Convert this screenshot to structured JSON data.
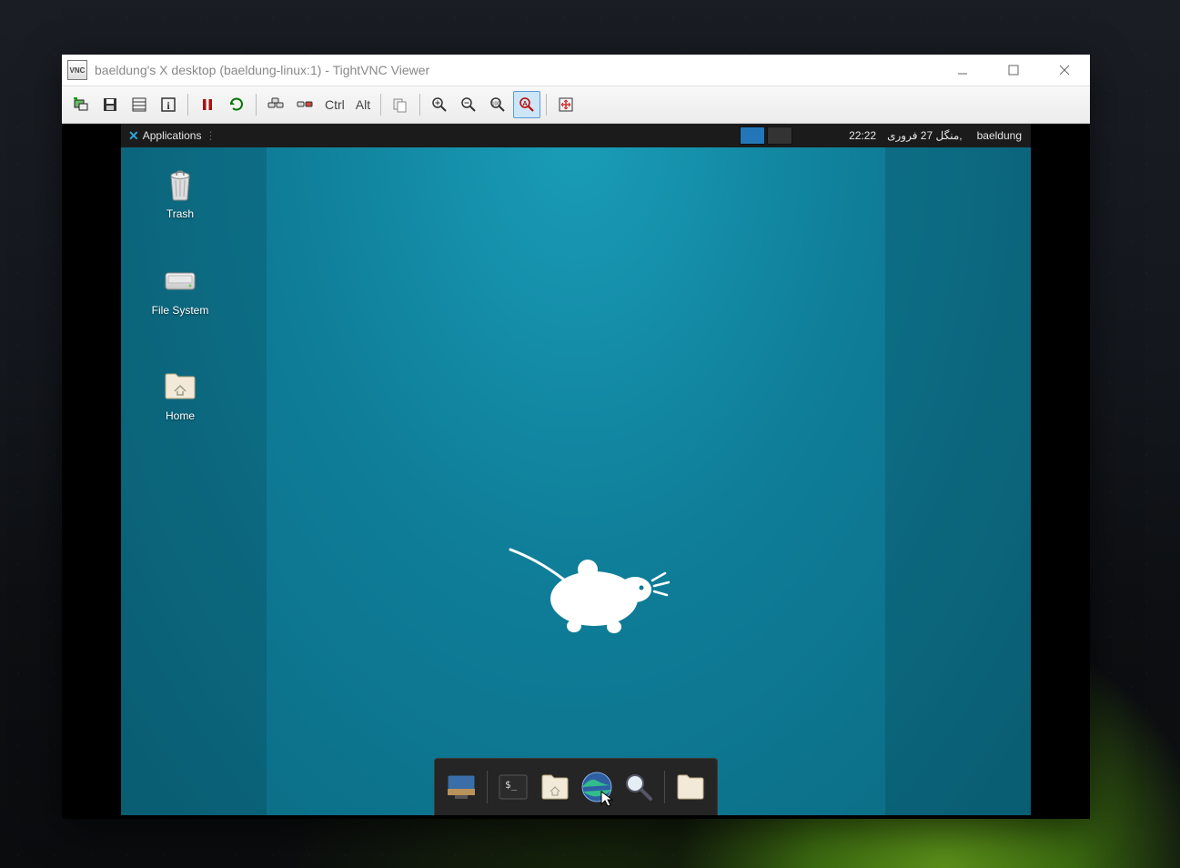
{
  "window": {
    "title": "baeldung's X desktop (baeldung-linux:1) - TightVNC Viewer",
    "app_icon_label": "VNC"
  },
  "vnc_toolbar": {
    "ctrl_label": "Ctrl",
    "alt_label": "Alt"
  },
  "xfce_panel": {
    "applications_label": "Applications",
    "time": "22:22",
    "date": "منگل 27 فروری,",
    "user": "baeldung"
  },
  "desktop_icons": {
    "trash": "Trash",
    "filesystem": "File System",
    "home": "Home"
  }
}
